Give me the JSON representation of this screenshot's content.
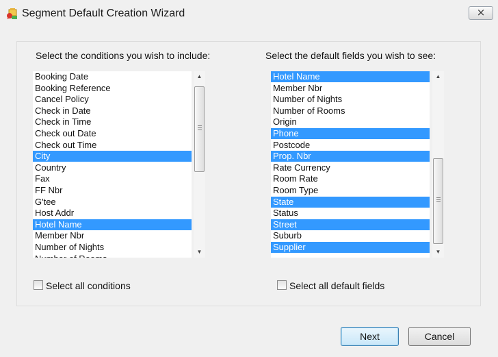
{
  "window": {
    "title": "Segment Default Creation Wizard",
    "close_label": "⨯"
  },
  "conditions": {
    "heading": "Select the conditions you wish to include:",
    "items": [
      {
        "label": "Booking Date",
        "selected": false
      },
      {
        "label": "Booking Reference",
        "selected": false
      },
      {
        "label": "Cancel Policy",
        "selected": false
      },
      {
        "label": "Check in Date",
        "selected": false
      },
      {
        "label": "Check in Time",
        "selected": false
      },
      {
        "label": "Check out Date",
        "selected": false
      },
      {
        "label": "Check out Time",
        "selected": false
      },
      {
        "label": "City",
        "selected": true
      },
      {
        "label": "Country",
        "selected": false
      },
      {
        "label": "Fax",
        "selected": false
      },
      {
        "label": "FF Nbr",
        "selected": false
      },
      {
        "label": "G'tee",
        "selected": false
      },
      {
        "label": "Host Addr",
        "selected": false
      },
      {
        "label": "Hotel Name",
        "selected": true
      },
      {
        "label": "Member Nbr",
        "selected": false
      },
      {
        "label": "Number of Nights",
        "selected": false
      },
      {
        "label": "Number of Rooms",
        "selected": false
      }
    ],
    "select_all_label": "Select all conditions",
    "select_all_checked": false
  },
  "fields": {
    "heading": "Select the default fields you wish to see:",
    "items": [
      {
        "label": "Hotel Name",
        "selected": true
      },
      {
        "label": "Member Nbr",
        "selected": false
      },
      {
        "label": "Number of Nights",
        "selected": false
      },
      {
        "label": "Number of Rooms",
        "selected": false
      },
      {
        "label": "Origin",
        "selected": false
      },
      {
        "label": "Phone",
        "selected": true
      },
      {
        "label": "Postcode",
        "selected": false
      },
      {
        "label": "Prop. Nbr",
        "selected": true
      },
      {
        "label": "Rate Currency",
        "selected": false
      },
      {
        "label": "Room Rate",
        "selected": false
      },
      {
        "label": "Room Type",
        "selected": false
      },
      {
        "label": "State",
        "selected": true
      },
      {
        "label": "Status",
        "selected": false
      },
      {
        "label": "Street",
        "selected": true
      },
      {
        "label": "Suburb",
        "selected": false
      },
      {
        "label": "Supplier",
        "selected": true
      }
    ],
    "select_all_label": "Select all default fields",
    "select_all_checked": false
  },
  "buttons": {
    "next_label": "Next",
    "cancel_label": "Cancel"
  },
  "colors": {
    "selection": "#3399ff",
    "background": "#f0f0f0"
  },
  "icons": {
    "app": "wizard-app-icon",
    "close": "close-icon",
    "scroll_up": "scroll-up-arrow-icon",
    "scroll_down": "scroll-down-arrow-icon"
  }
}
